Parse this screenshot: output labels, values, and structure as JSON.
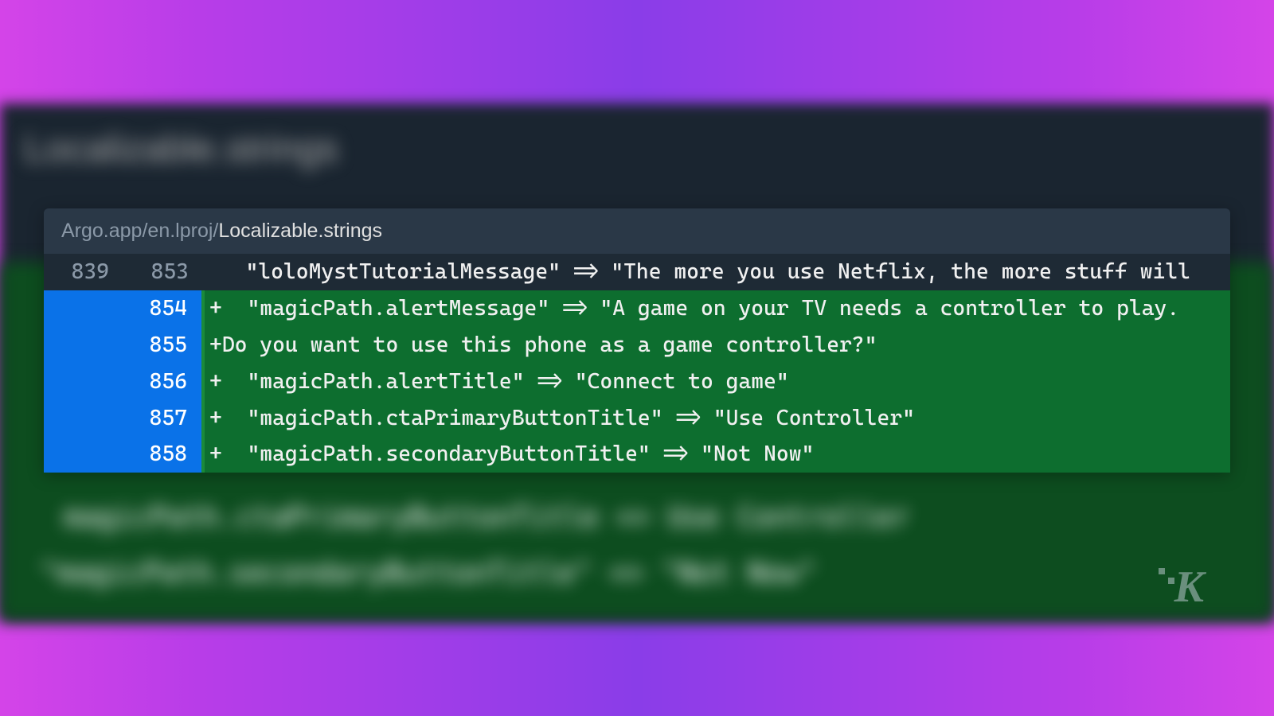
{
  "backdrop": {
    "title": "Localizable.strings",
    "blur_line1": "magicPath.ctaPrimaryButtonTitle  =>  Use Controller",
    "blur_line2": "\"magicPath.secondaryButtonTitle\" => \"Not Now\""
  },
  "file": {
    "path_prefix": "Argo.app/en.lproj/",
    "path_name": "Localizable.strings"
  },
  "rows": [
    {
      "old": "839",
      "new": "853",
      "type": "context",
      "code": "   \"loloMystTutorialMessage\" => \"The more you use Netflix, the more stuff will"
    },
    {
      "old": "",
      "new": "854",
      "type": "added",
      "code": "+  \"magicPath.alertMessage\" => \"A game on your TV needs a controller to play."
    },
    {
      "old": "",
      "new": "855",
      "type": "added",
      "code": "+Do you want to use this phone as a game controller?\""
    },
    {
      "old": "",
      "new": "856",
      "type": "added",
      "code": "+  \"magicPath.alertTitle\" => \"Connect to game\""
    },
    {
      "old": "",
      "new": "857",
      "type": "added",
      "code": "+  \"magicPath.ctaPrimaryButtonTitle\" => \"Use Controller\""
    },
    {
      "old": "",
      "new": "858",
      "type": "added",
      "code": "+  \"magicPath.secondaryButtonTitle\" => \"Not Now\""
    }
  ],
  "watermark": "K"
}
